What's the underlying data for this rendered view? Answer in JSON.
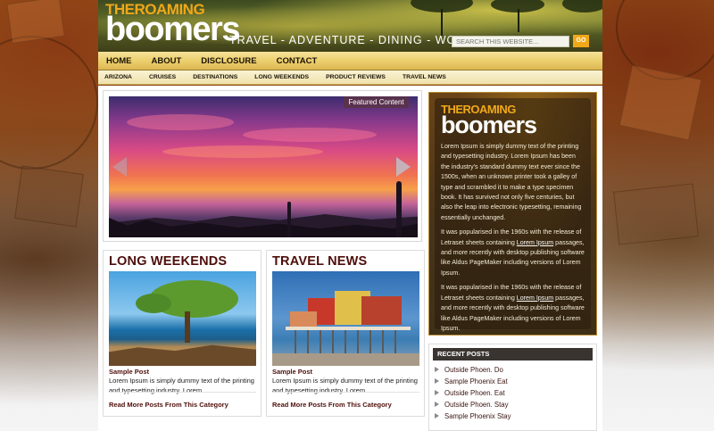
{
  "site": {
    "logo_top": "THEROAMING",
    "logo_main": "boomers",
    "tagline": "TRAVEL - ADVENTURE - DINING - WONDER"
  },
  "search": {
    "placeholder": "SEARCH THIS WEBSITE...",
    "button_label": "GO"
  },
  "main_nav": [
    "HOME",
    "ABOUT",
    "DISCLOSURE",
    "CONTACT"
  ],
  "sub_nav": [
    "ARIZONA",
    "CRUISES",
    "DESTINATIONS",
    "LONG WEEKENDS",
    "PRODUCT REVIEWS",
    "TRAVEL NEWS"
  ],
  "featured": {
    "badge": "Featured Content"
  },
  "categories": [
    {
      "title": "LONG WEEKENDS",
      "post_title": "Sample Post",
      "excerpt": "Lorem Ipsum is simply dummy text of the printing and typesetting industry. Lorem...",
      "more_link": "Read More Posts From This Category"
    },
    {
      "title": "TRAVEL NEWS",
      "post_title": "Sample Post",
      "excerpt": "Lorem Ipsum is simply dummy text of the printing and typesetting industry. Lorem...",
      "more_link": "Read More Posts From This Category"
    }
  ],
  "about": {
    "logo_top": "THEROAMING",
    "logo_main": "boomers",
    "p1": "Lorem Ipsum is simply dummy text of the printing and typesetting industry. Lorem Ipsum has been the industry's standard dummy text ever since the 1500s, when an unknown printer took a galley of type and scrambled it to make a type specimen book. It has survived not only five centuries, but also the leap into electronic typesetting, remaining essentially unchanged.",
    "p2_before": "It was popularised in the 1960s with the release of Letraset sheets containing ",
    "p2_link": "Lorem Ipsum",
    "p2_after": " passages, and more recently with desktop publishing software like Aldus PageMaker including versions of Lorem Ipsum.",
    "p3_before": "It was popularised in the 1960s with the release of Letraset sheets containing ",
    "p3_link": "Lorem Ipsum",
    "p3_after": " passages, and more recently with desktop publishing software like Aldus PageMaker including versions of Lorem Ipsum."
  },
  "recent_posts": {
    "heading": "RECENT POSTS",
    "items": [
      "Outside Phoen. Do",
      "Sample Phoenix Eat",
      "Outside Phoen. Eat",
      "Outside Phoen. Stay",
      "Sample Phoenix Stay"
    ]
  }
}
